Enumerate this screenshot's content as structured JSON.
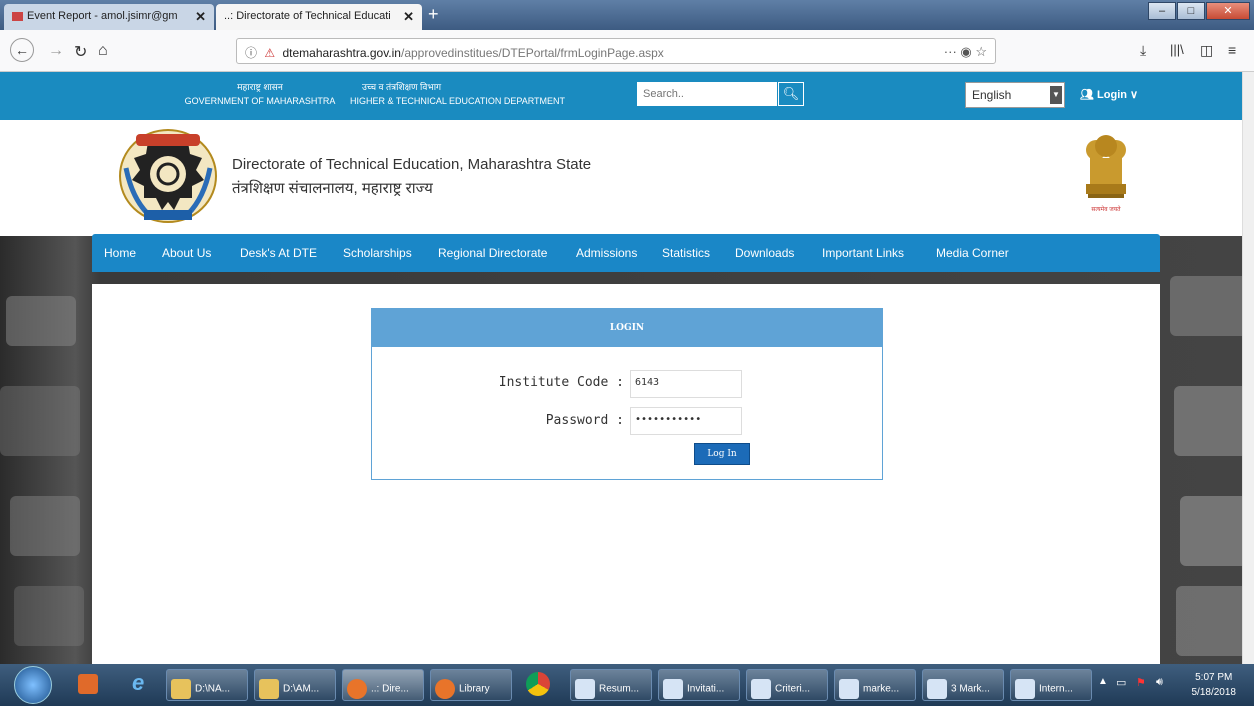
{
  "browser": {
    "tabs": [
      {
        "label": "Event Report - amol.jsimr@gm"
      },
      {
        "label": "..: Directorate of Technical Educati"
      }
    ],
    "new_tab_label": "+",
    "url_domain": "dtemaharashtra.gov.in",
    "url_path": "/approvedinstitues/DTEPortal/frmLoginPage.aspx",
    "url_actions": "···  ◉  ☆"
  },
  "site": {
    "gov_hi": "महाराष्ट्र शासन",
    "gov_en": "GOVERNMENT OF MAHARASHTRA",
    "dept_hi": "उच्च व तंत्रशिक्षण विभाग",
    "dept_en": "HIGHER & TECHNICAL EDUCATION DEPARTMENT",
    "search_placeholder": "Search..",
    "language": "English",
    "login_label": "Login ∨",
    "title_en": "Directorate of Technical Education, Maharashtra State",
    "title_hi": "तंत्रशिक्षण संचालनालय, महाराष्ट्र राज्य",
    "emblem_text": "सत्यमेव जयते"
  },
  "menu": [
    {
      "label": "Home"
    },
    {
      "label": "About Us"
    },
    {
      "label": "Desk's At DTE"
    },
    {
      "label": "Scholarships"
    },
    {
      "label": "Regional Directorate"
    },
    {
      "label": "Admissions"
    },
    {
      "label": "Statistics"
    },
    {
      "label": "Downloads"
    },
    {
      "label": "Important Links"
    },
    {
      "label": "Media Corner"
    }
  ],
  "login": {
    "heading": "LOGIN",
    "institute_code_label": "Institute Code :",
    "institute_code_value": "6143",
    "password_label": "Password :",
    "password_value": "•••••••••••",
    "button_label": "Log In"
  },
  "taskbar": {
    "tasks": [
      {
        "label": "D:\\NA..."
      },
      {
        "label": "D:\\AM..."
      },
      {
        "label": "..: Dire..."
      },
      {
        "label": "Library"
      },
      {
        "label": "Resum..."
      },
      {
        "label": "Invitati..."
      },
      {
        "label": "Criteri..."
      },
      {
        "label": "marke..."
      },
      {
        "label": "3 Mark..."
      },
      {
        "label": "Intern..."
      }
    ],
    "time": "5:07 PM",
    "date": "5/18/2018"
  }
}
